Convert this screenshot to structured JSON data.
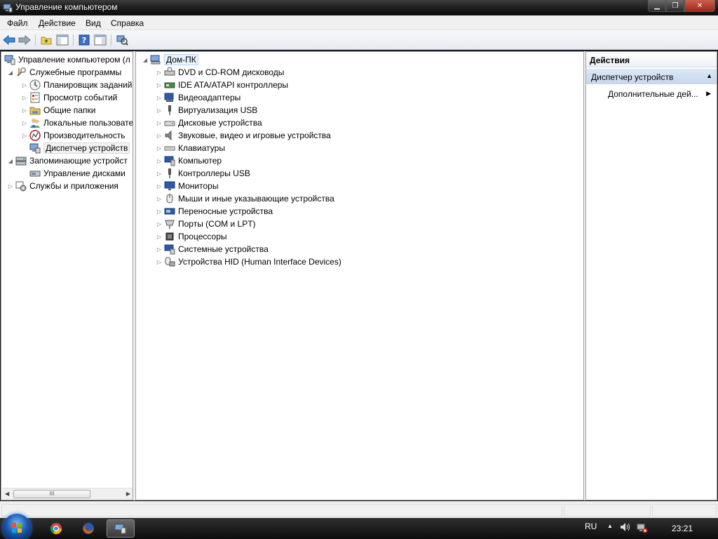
{
  "window": {
    "title": "Управление компьютером",
    "controls": {
      "minimize": "▁",
      "maximize": "❐",
      "close": "✕"
    }
  },
  "menu": [
    "Файл",
    "Действие",
    "Вид",
    "Справка"
  ],
  "toolbar": {
    "icons": [
      "back-arrow-icon",
      "forward-arrow-icon",
      "up-folder-icon",
      "show-hide-console-tree-icon",
      "help-icon",
      "show-hide-action-pane-icon",
      "scan-hardware-icon"
    ]
  },
  "left_tree": {
    "items": [
      {
        "label": "Управление компьютером (л",
        "icon": "computer-management-icon",
        "level": 0,
        "expander": ""
      },
      {
        "label": "Служебные программы",
        "icon": "tools-icon",
        "level": 1,
        "expander": "◢"
      },
      {
        "label": "Планировщик заданий",
        "icon": "clock-icon",
        "level": 2,
        "expander": "▷"
      },
      {
        "label": "Просмотр событий",
        "icon": "event-viewer-icon",
        "level": 2,
        "expander": "▷"
      },
      {
        "label": "Общие папки",
        "icon": "shared-folders-icon",
        "level": 2,
        "expander": "▷"
      },
      {
        "label": "Локальные пользовате",
        "icon": "users-icon",
        "level": 2,
        "expander": "▷"
      },
      {
        "label": "Производительность",
        "icon": "performance-icon",
        "level": 2,
        "expander": "▷"
      },
      {
        "label": "Диспетчер устройств",
        "icon": "device-manager-icon",
        "level": 2,
        "expander": "",
        "selected": true
      },
      {
        "label": "Запоминающие устройст",
        "icon": "storage-icon",
        "level": 1,
        "expander": "◢"
      },
      {
        "label": "Управление дисками",
        "icon": "disk-management-icon",
        "level": 2,
        "expander": ""
      },
      {
        "label": "Службы и приложения",
        "icon": "services-icon",
        "level": 1,
        "expander": "▷"
      }
    ],
    "hscroll_thumb": "III"
  },
  "device_tree": {
    "root": "Дом-ПК",
    "categories": [
      {
        "label": "DVD и CD-ROM дисководы",
        "icon": "dvd-drive-icon"
      },
      {
        "label": "IDE ATA/ATAPI контроллеры",
        "icon": "ide-controller-icon"
      },
      {
        "label": "Видеоадаптеры",
        "icon": "display-adapter-icon"
      },
      {
        "label": "Виртуализация USB",
        "icon": "usb-virtualization-icon"
      },
      {
        "label": "Дисковые устройства",
        "icon": "disk-drive-icon"
      },
      {
        "label": "Звуковые, видео и игровые устройства",
        "icon": "sound-icon"
      },
      {
        "label": "Клавиатуры",
        "icon": "keyboard-icon"
      },
      {
        "label": "Компьютер",
        "icon": "computer-icon"
      },
      {
        "label": "Контроллеры USB",
        "icon": "usb-controller-icon"
      },
      {
        "label": "Мониторы",
        "icon": "monitor-icon"
      },
      {
        "label": "Мыши и иные указывающие устройства",
        "icon": "mouse-icon"
      },
      {
        "label": "Переносные устройства",
        "icon": "portable-device-icon"
      },
      {
        "label": "Порты (COM и LPT)",
        "icon": "ports-icon"
      },
      {
        "label": "Процессоры",
        "icon": "processor-icon"
      },
      {
        "label": "Системные устройства",
        "icon": "system-devices-icon"
      },
      {
        "label": "Устройства HID (Human Interface Devices)",
        "icon": "hid-icon"
      }
    ]
  },
  "actions": {
    "header": "Действия",
    "section": "Диспетчер устройств",
    "item": "Дополнительные дей..."
  },
  "taskbar": {
    "apps": [
      "chrome-icon",
      "firefox-icon",
      "computer-management-icon"
    ],
    "language": "RU",
    "clock": "23:21"
  }
}
